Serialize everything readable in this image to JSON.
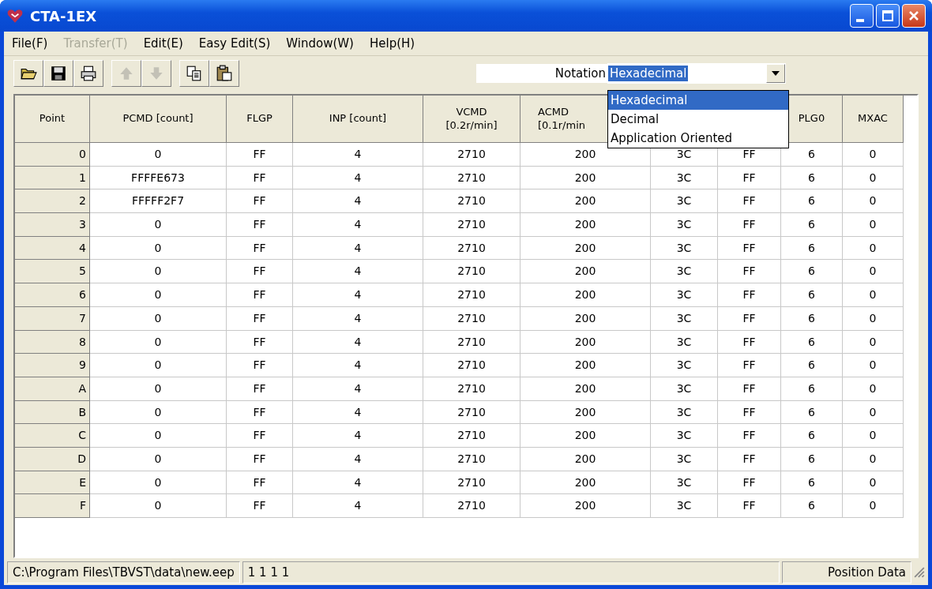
{
  "window": {
    "title": "CTA-1EX"
  },
  "menu": [
    {
      "label": "File(F)",
      "disabled": false
    },
    {
      "label": "Transfer(T)",
      "disabled": true
    },
    {
      "label": "Edit(E)",
      "disabled": false
    },
    {
      "label": "Easy Edit(S)",
      "disabled": false
    },
    {
      "label": "Window(W)",
      "disabled": false
    },
    {
      "label": "Help(H)",
      "disabled": false
    }
  ],
  "toolbar": [
    {
      "kind": "open",
      "disabled": false
    },
    {
      "kind": "save",
      "disabled": false
    },
    {
      "kind": "print",
      "disabled": false
    },
    {
      "kind": "up",
      "disabled": true
    },
    {
      "kind": "down",
      "disabled": true
    },
    {
      "kind": "copy",
      "disabled": false
    },
    {
      "kind": "paste",
      "disabled": false
    }
  ],
  "notation": {
    "label": "Notation",
    "value": "Hexadecimal",
    "expanded": true,
    "options": [
      {
        "label": "Hexadecimal",
        "selected": true
      },
      {
        "label": "Decimal",
        "selected": false
      },
      {
        "label": "Application Oriented",
        "selected": false
      }
    ]
  },
  "table": {
    "columns": [
      {
        "label": "Point"
      },
      {
        "label": "PCMD [count]"
      },
      {
        "label": "FLGP"
      },
      {
        "label": "INP [count]"
      },
      {
        "label": "VCMD\n[0.2r/min]"
      },
      {
        "label": "ACMD\n[0.1r/min"
      },
      {},
      {},
      {
        "label": "PLG0"
      },
      {
        "label": "MXAC"
      }
    ],
    "rows": [
      [
        "0",
        "0",
        "FF",
        "4",
        "2710",
        "200",
        "3C",
        "FF",
        "6",
        "0"
      ],
      [
        "1",
        "FFFFE673",
        "FF",
        "4",
        "2710",
        "200",
        "3C",
        "FF",
        "6",
        "0"
      ],
      [
        "2",
        "FFFFF2F7",
        "FF",
        "4",
        "2710",
        "200",
        "3C",
        "FF",
        "6",
        "0"
      ],
      [
        "3",
        "0",
        "FF",
        "4",
        "2710",
        "200",
        "3C",
        "FF",
        "6",
        "0"
      ],
      [
        "4",
        "0",
        "FF",
        "4",
        "2710",
        "200",
        "3C",
        "FF",
        "6",
        "0"
      ],
      [
        "5",
        "0",
        "FF",
        "4",
        "2710",
        "200",
        "3C",
        "FF",
        "6",
        "0"
      ],
      [
        "6",
        "0",
        "FF",
        "4",
        "2710",
        "200",
        "3C",
        "FF",
        "6",
        "0"
      ],
      [
        "7",
        "0",
        "FF",
        "4",
        "2710",
        "200",
        "3C",
        "FF",
        "6",
        "0"
      ],
      [
        "8",
        "0",
        "FF",
        "4",
        "2710",
        "200",
        "3C",
        "FF",
        "6",
        "0"
      ],
      [
        "9",
        "0",
        "FF",
        "4",
        "2710",
        "200",
        "3C",
        "FF",
        "6",
        "0"
      ],
      [
        "A",
        "0",
        "FF",
        "4",
        "2710",
        "200",
        "3C",
        "FF",
        "6",
        "0"
      ],
      [
        "B",
        "0",
        "FF",
        "4",
        "2710",
        "200",
        "3C",
        "FF",
        "6",
        "0"
      ],
      [
        "C",
        "0",
        "FF",
        "4",
        "2710",
        "200",
        "3C",
        "FF",
        "6",
        "0"
      ],
      [
        "D",
        "0",
        "FF",
        "4",
        "2710",
        "200",
        "3C",
        "FF",
        "6",
        "0"
      ],
      [
        "E",
        "0",
        "FF",
        "4",
        "2710",
        "200",
        "3C",
        "FF",
        "6",
        "0"
      ],
      [
        "F",
        "0",
        "FF",
        "4",
        "2710",
        "200",
        "3C",
        "FF",
        "6",
        "0"
      ]
    ]
  },
  "status_bar": [
    "C:\\Program Files\\TBVST\\data\\new.eep",
    "1 1 1 1",
    "Position Data"
  ]
}
